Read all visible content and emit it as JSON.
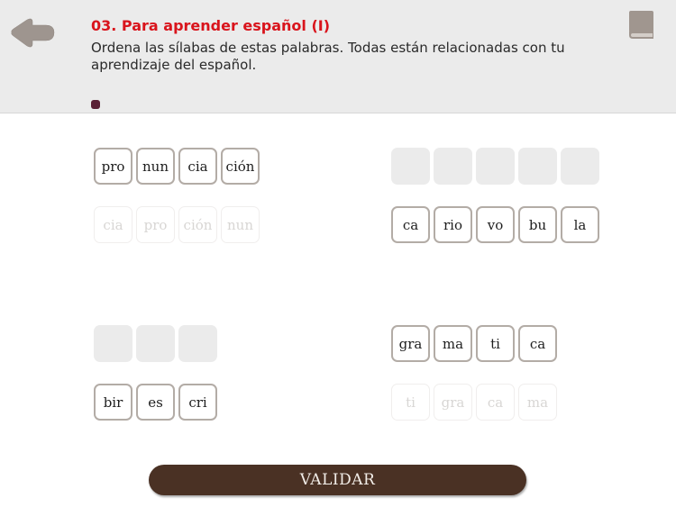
{
  "header": {
    "title": "03. Para aprender español (I)",
    "instructions": "Ordena las sílabas de estas palabras. Todas están relacionadas con tu aprendizaje del español.",
    "back_icon": "arrow-left-icon",
    "book_icon": "book-icon",
    "progress": {
      "current": 1,
      "total": 1,
      "color": "#5a2035"
    },
    "title_color": "#d9141c"
  },
  "exercises": [
    {
      "id": "pronunciacion",
      "answer_row": [
        "pro",
        "nun",
        "cia",
        "ción"
      ],
      "answer_state": "filled",
      "source_row": [
        "cia",
        "pro",
        "ción",
        "nun"
      ],
      "source_state": "used"
    },
    {
      "id": "vocabulario",
      "answer_row": [
        "",
        "",
        "",
        "",
        ""
      ],
      "answer_state": "empty",
      "source_row": [
        "ca",
        "rio",
        "vo",
        "bu",
        "la"
      ],
      "source_state": "available"
    },
    {
      "id": "escribir",
      "answer_row": [
        "",
        "",
        ""
      ],
      "answer_state": "empty",
      "source_row": [
        "bir",
        "es",
        "cri"
      ],
      "source_state": "available"
    },
    {
      "id": "gramatica",
      "answer_row": [
        "gra",
        "ma",
        "ti",
        "ca"
      ],
      "answer_state": "filled",
      "source_row": [
        "ti",
        "gra",
        "ca",
        "ma"
      ],
      "source_state": "used"
    }
  ],
  "footer": {
    "validate_label": "VALIDAR",
    "button_color": "#4a3124"
  }
}
